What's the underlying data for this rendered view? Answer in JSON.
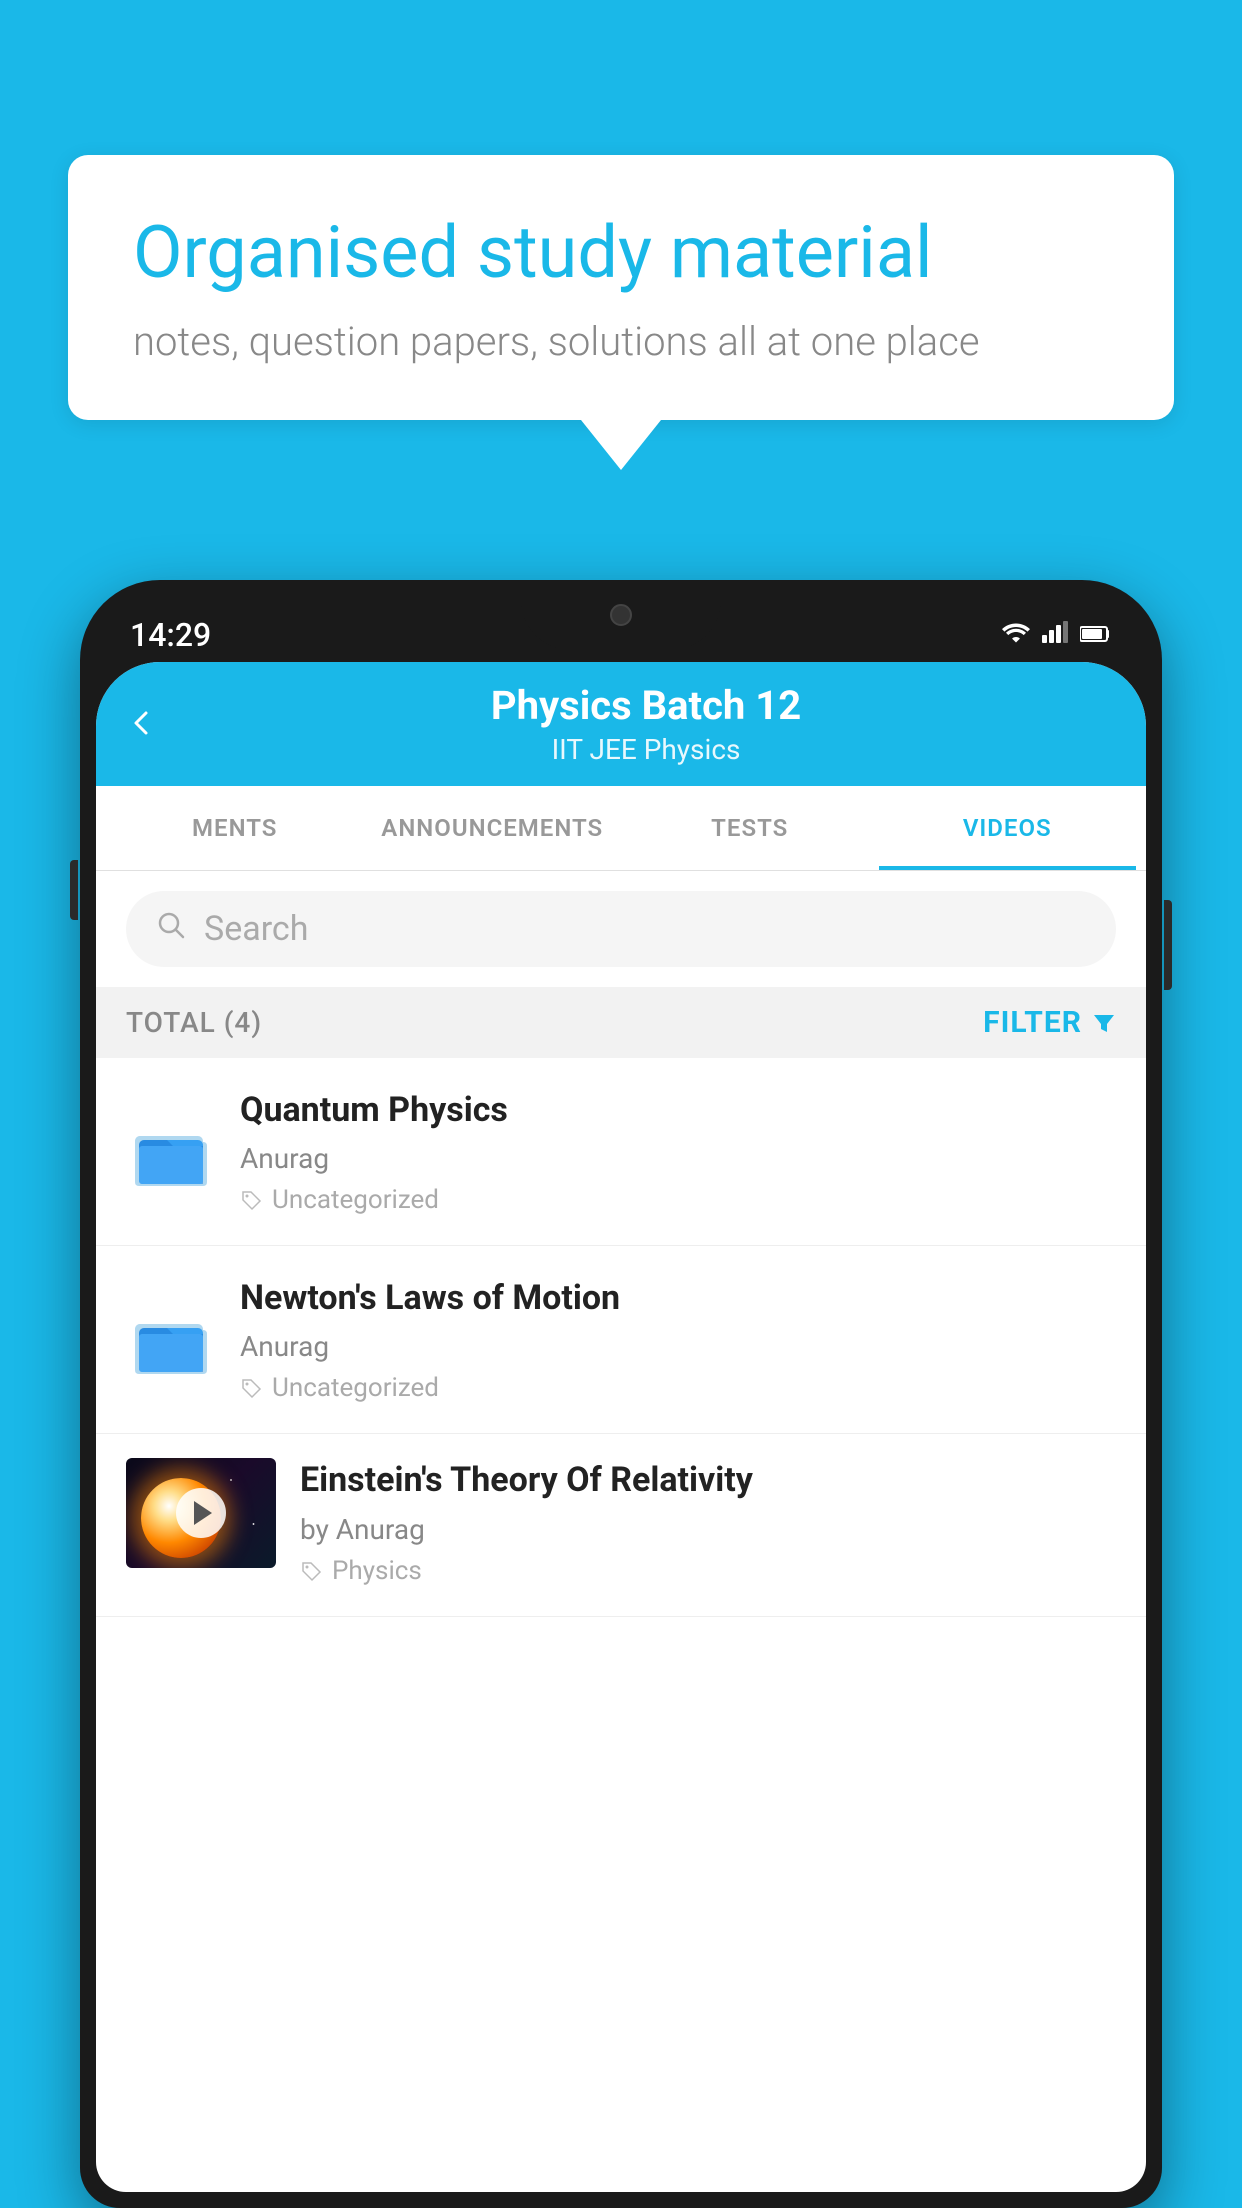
{
  "background_color": "#1ab8e8",
  "speech_bubble": {
    "title": "Organised study material",
    "subtitle": "notes, question papers, solutions all at one place"
  },
  "phone": {
    "time": "14:29",
    "header": {
      "title": "Physics Batch 12",
      "subtitle": "IIT JEE    Physics",
      "back_label": "←"
    },
    "tabs": [
      {
        "label": "MENTS",
        "active": false
      },
      {
        "label": "ANNOUNCEMENTS",
        "active": false
      },
      {
        "label": "TESTS",
        "active": false
      },
      {
        "label": "VIDEOS",
        "active": true
      }
    ],
    "search": {
      "placeholder": "Search"
    },
    "filter": {
      "total_label": "TOTAL (4)",
      "filter_label": "FILTER"
    },
    "videos": [
      {
        "title": "Quantum Physics",
        "author": "Anurag",
        "tag": "Uncategorized",
        "type": "folder"
      },
      {
        "title": "Newton's Laws of Motion",
        "author": "Anurag",
        "tag": "Uncategorized",
        "type": "folder"
      },
      {
        "title": "Einstein's Theory Of Relativity",
        "author": "by Anurag",
        "tag": "Physics",
        "type": "video"
      }
    ]
  }
}
